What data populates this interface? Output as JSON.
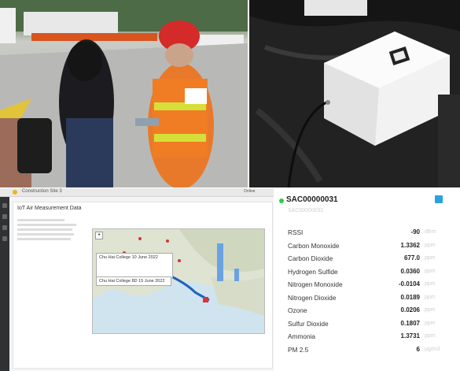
{
  "app": {
    "tab_title": "Construction Site 3",
    "card_title": "IoT Air Measurement Data",
    "top_right": "Online"
  },
  "map": {
    "popup_title": "Chu Hai College 10 June 2022",
    "popup_label": "Chu Hai College 8D 15 June 2022"
  },
  "device_panel": {
    "device_id": "SAC00000031",
    "subtitle": "SAC00000031",
    "status_color": "#2ecc40",
    "readings": [
      {
        "name": "RSSI",
        "value": "-90",
        "unit": "dBm"
      },
      {
        "name": "Carbon Monoxide",
        "value": "1.3362",
        "unit": "ppm"
      },
      {
        "name": "Carbon Dioxide",
        "value": "677.0",
        "unit": "ppm"
      },
      {
        "name": "Hydrogen Sulfide",
        "value": "0.0360",
        "unit": "ppm"
      },
      {
        "name": "Nitrogen Monoxide",
        "value": "-0.0104",
        "unit": "ppm"
      },
      {
        "name": "Nitrogen Dioxide",
        "value": "0.0189",
        "unit": "ppm"
      },
      {
        "name": "Ozone",
        "value": "0.0206",
        "unit": "ppm"
      },
      {
        "name": "Sulfur Dioxide",
        "value": "0.1807",
        "unit": "ppm"
      },
      {
        "name": "Ammonia",
        "value": "1.3731",
        "unit": "ppm"
      },
      {
        "name": "PM 2.5",
        "value": "6",
        "unit": "µg/m3"
      }
    ]
  },
  "colors": {
    "accent": "#29a3e0",
    "route": "#1f5fbf",
    "marker": "#d9343a"
  }
}
